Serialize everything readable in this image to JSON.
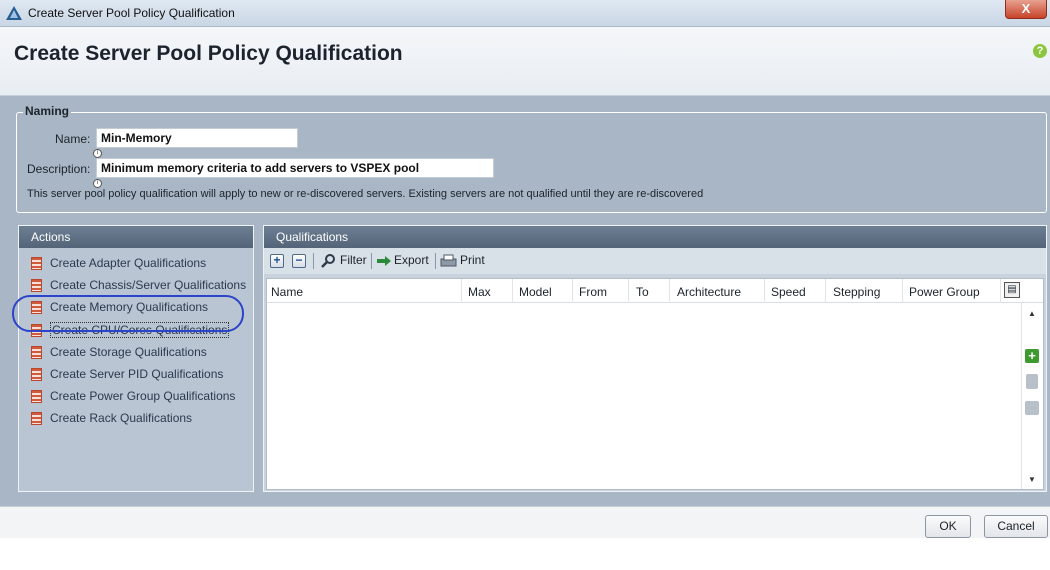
{
  "window": {
    "title": "Create Server Pool Policy Qualification",
    "close_glyph": "X"
  },
  "header": {
    "title": "Create Server Pool Policy Qualification",
    "help_glyph": "?"
  },
  "naming": {
    "legend": "Naming",
    "name_label": "Name:",
    "name_value": "Min-Memory",
    "description_label": "Description:",
    "description_value": "Minimum memory criteria to add servers to VSPEX pool",
    "info_glyph": "i",
    "note": "This server pool policy qualification will apply to new or re-discovered servers. Existing servers are not qualified until they are re-discovered"
  },
  "actions": {
    "title": "Actions",
    "items": [
      {
        "label": "Create Adapter Qualifications"
      },
      {
        "label": "Create Chassis/Server Qualifications"
      },
      {
        "label": "Create Memory Qualifications"
      },
      {
        "label": "Create CPU/Cores Qualifications"
      },
      {
        "label": "Create Storage Qualifications"
      },
      {
        "label": "Create Server PID Qualifications"
      },
      {
        "label": "Create Power Group Qualifications"
      },
      {
        "label": "Create Rack Qualifications"
      }
    ]
  },
  "qualifications": {
    "title": "Qualifications",
    "toolbar": {
      "add_glyph": "+",
      "remove_glyph": "−",
      "filter": "Filter",
      "export": "Export",
      "print": "Print"
    },
    "columns": [
      "Name",
      "Max",
      "Model",
      "From",
      "To",
      "Architecture",
      "Speed",
      "Stepping",
      "Power Group"
    ],
    "rows": []
  },
  "side_toolbar": {
    "add_glyph": "+"
  },
  "footer": {
    "ok": "OK",
    "cancel": "Cancel"
  },
  "colors": {
    "panel_bg": "#a9b6c5",
    "panel_header": "#5c6d81",
    "highlight_oval": "#2b44c9",
    "add_green": "#3e9a2f"
  },
  "icons": [
    "app-logo-icon",
    "window-close-icon",
    "help-icon",
    "info-icon",
    "action-policy-icon",
    "add-icon",
    "remove-icon",
    "filter-icon",
    "export-icon",
    "print-icon",
    "column-chooser-icon",
    "scroll-up-icon",
    "scroll-down-icon",
    "side-add-icon",
    "trash-icon",
    "copy-icon"
  ]
}
